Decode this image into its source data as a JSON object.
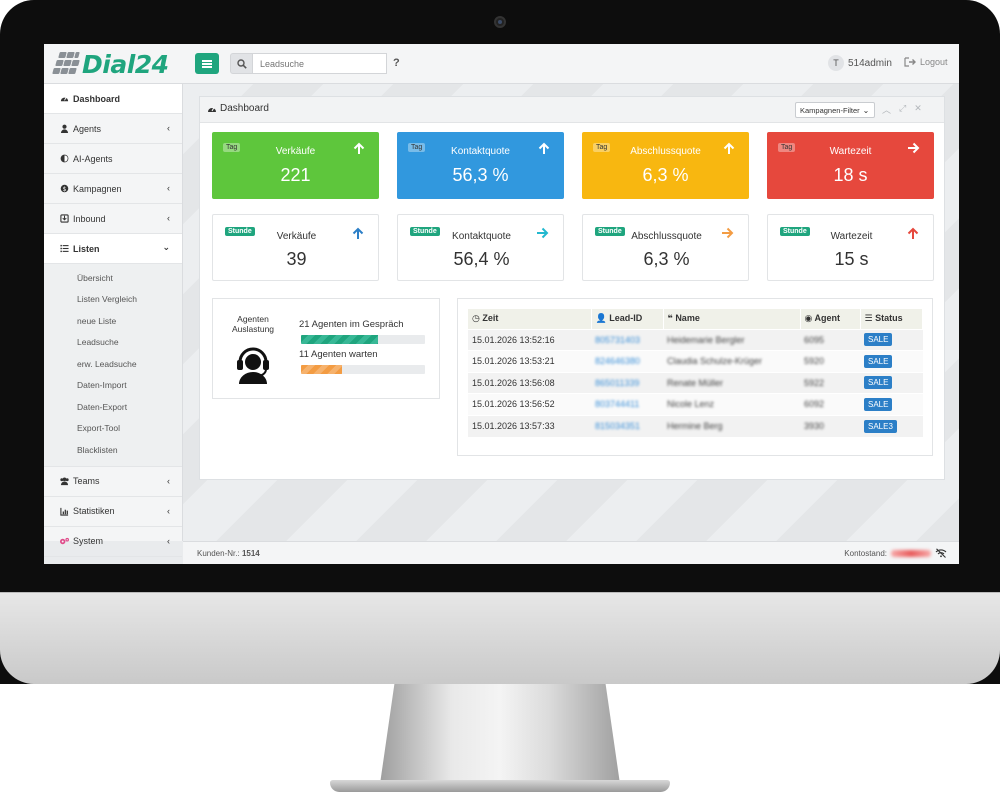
{
  "app": {
    "logo_text": "Dial24",
    "brand_color": "#1fa57e"
  },
  "topbar": {
    "search_button_icon": "search-icon",
    "search_placeholder": "Leadsuche",
    "help_label": "?",
    "user_initial": "T",
    "user_name": "514admin",
    "logout_label": "Logout"
  },
  "sidebar": {
    "items": [
      {
        "label": "Dashboard",
        "icon": "dashboard-icon",
        "active": true
      },
      {
        "label": "Agents",
        "icon": "user-icon",
        "has_children": true
      },
      {
        "label": "AI-Agents",
        "icon": "ai-icon"
      },
      {
        "label": "Kampagnen",
        "icon": "campaign-icon",
        "has_children": true
      },
      {
        "label": "Inbound",
        "icon": "inbound-icon",
        "has_children": true
      },
      {
        "label": "Listen",
        "icon": "list-icon",
        "expanded": true
      },
      {
        "label": "Teams",
        "icon": "team-icon",
        "has_children": true
      },
      {
        "label": "Statistiken",
        "icon": "chart-icon",
        "has_children": true
      },
      {
        "label": "System",
        "icon": "gears-icon",
        "has_children": true
      }
    ],
    "listen_sub": [
      "Übersicht",
      "Listen Vergleich",
      "neue Liste",
      "Leadsuche",
      "erw. Leadsuche",
      "Daten-Import",
      "Daten-Export",
      "Export-Tool",
      "Blacklisten"
    ]
  },
  "panel": {
    "title": "Dashboard",
    "filter_label": "Kampagnen-Filter"
  },
  "kpis_day": [
    {
      "tag": "Tag",
      "label": "Verkäufe",
      "value": "221",
      "color": "#5ec63c",
      "arrow": "up"
    },
    {
      "tag": "Tag",
      "label": "Kontaktquote",
      "value": "56,3 %",
      "color": "#3198de",
      "arrow": "up"
    },
    {
      "tag": "Tag",
      "label": "Abschlussquote",
      "value": "6,3 %",
      "color": "#f8b710",
      "arrow": "up"
    },
    {
      "tag": "Tag",
      "label": "Wartezeit",
      "value": "18 s",
      "color": "#e6483d",
      "arrow": "right"
    }
  ],
  "kpis_hour": [
    {
      "tag": "Stunde",
      "label": "Verkäufe",
      "value": "39",
      "arrow": "up",
      "arrow_color": "#2c7fc7"
    },
    {
      "tag": "Stunde",
      "label": "Kontaktquote",
      "value": "56,4 %",
      "arrow": "right",
      "arrow_color": "#22b8cf"
    },
    {
      "tag": "Stunde",
      "label": "Abschlussquote",
      "value": "6,3 %",
      "arrow": "right",
      "arrow_color": "#f39c43"
    },
    {
      "tag": "Stunde",
      "label": "Wartezeit",
      "value": "15 s",
      "arrow": "up",
      "arrow_color": "#e6483d"
    }
  ],
  "agents": {
    "label": "Agenten Auslastung",
    "icon": "headset-icon",
    "in_call_text": "21 Agenten im Gespräch",
    "in_call_fraction": 0.62,
    "waiting_text": "11 Agenten warten",
    "waiting_fraction": 0.33
  },
  "table": {
    "headers": [
      "Zeit",
      "Lead-ID",
      "Name",
      "Agent",
      "Status"
    ],
    "rows": [
      {
        "zeit": "15.01.2026 13:52:16",
        "lead": "805731403",
        "name": "Heidemarie Bergler",
        "agent": "6095",
        "status": "SALE"
      },
      {
        "zeit": "15.01.2026 13:53:21",
        "lead": "824646380",
        "name": "Claudia Schulze-Krüger",
        "agent": "5920",
        "status": "SALE"
      },
      {
        "zeit": "15.01.2026 13:56:08",
        "lead": "865011339",
        "name": "Renate Müller",
        "agent": "5922",
        "status": "SALE"
      },
      {
        "zeit": "15.01.2026 13:56:52",
        "lead": "803744411",
        "name": "Nicole Lenz",
        "agent": "6092",
        "status": "SALE"
      },
      {
        "zeit": "15.01.2026 13:57:33",
        "lead": "815034351",
        "name": "Hermine Berg",
        "agent": "3930",
        "status": "SALE3"
      }
    ]
  },
  "footer": {
    "customer_label": "Kunden-Nr.:",
    "customer_number": "1514",
    "balance_label": "Kontostand:"
  }
}
